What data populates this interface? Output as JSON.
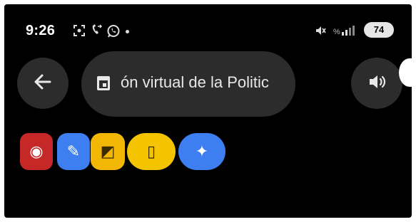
{
  "status_bar": {
    "time": "9:26",
    "left_icons": [
      "screenshot-icon",
      "call-forward-icon",
      "whatsapp-icon"
    ],
    "right_icons": [
      "mute-icon",
      "signal-icon"
    ],
    "battery": "74"
  },
  "toolbar": {
    "search_text": "ón virtual de la Politic",
    "back_icon": "arrow-left-icon",
    "event_icon": "calendar-icon",
    "volume_icon": "volume-icon"
  },
  "apps": [
    {
      "name": "recorder-app-icon",
      "glyph": "◉",
      "color": "#c62828"
    },
    {
      "name": "pen-app-icon",
      "glyph": "✎",
      "color": "#3d7ff0"
    },
    {
      "name": "edit-app-icon",
      "glyph": "◩",
      "color": "#f2b705"
    },
    {
      "name": "door-app-icon",
      "glyph": "▯",
      "color": "#f5c400"
    },
    {
      "name": "assistant-app-icon",
      "glyph": "✦",
      "color": "#3d7ff0"
    }
  ]
}
